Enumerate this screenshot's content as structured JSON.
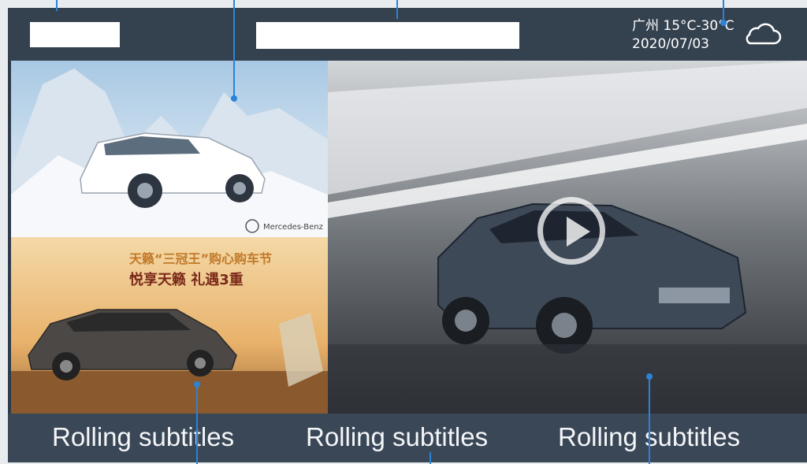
{
  "header": {
    "city": "广州",
    "temperature": "15°C-30°C",
    "date": "2020/07/03",
    "weather_icon": "cloud-icon"
  },
  "panels": {
    "top_left": {
      "brand": "Mercedes-Benz"
    },
    "bottom_left": {
      "headline_1": "天籁“三冠王”购心购车节",
      "headline_2": "悦享天籁 礼遇3重"
    },
    "main_video": {
      "play_icon": "play-icon"
    }
  },
  "subtitles": [
    "Rolling subtitles",
    "Rolling subtitles",
    "Rolling subtitles"
  ],
  "colors": {
    "bar": "#34414f",
    "subtitle_bar": "#3a4757",
    "callout": "#2b83d8"
  }
}
